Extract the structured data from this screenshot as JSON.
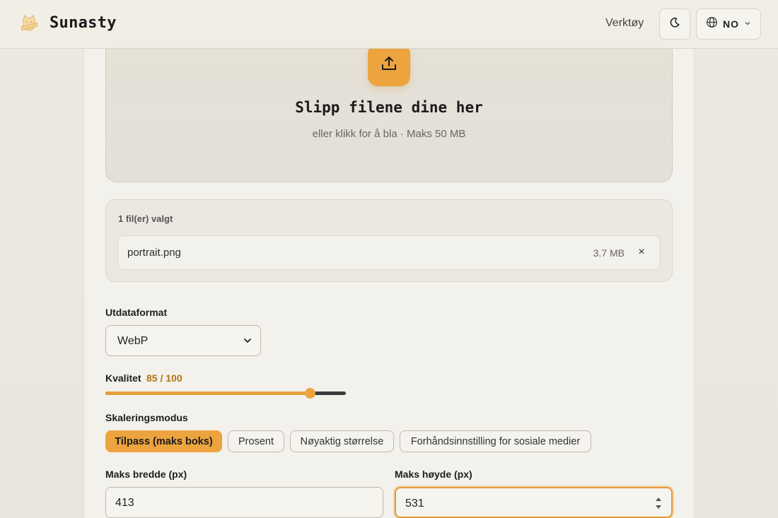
{
  "header": {
    "brand": "Sunasty",
    "tools_label": "Verktøy",
    "language_code": "NO"
  },
  "dropzone": {
    "title": "Slipp filene dine her",
    "subtitle": "eller klikk for å bla · Maks 50 MB"
  },
  "files": {
    "count_label": "1 fil(er) valgt",
    "items": [
      {
        "name": "portrait.png",
        "size": "3.7 MB",
        "remove": "×"
      }
    ]
  },
  "output_format": {
    "label": "Utdataformat",
    "selected": "WebP"
  },
  "quality": {
    "label": "Kvalitet",
    "value_text": "85 / 100",
    "value": 85,
    "max": 100
  },
  "scaling": {
    "label": "Skaleringsmodus",
    "modes": [
      {
        "label": "Tilpass (maks boks)",
        "active": true
      },
      {
        "label": "Prosent",
        "active": false
      },
      {
        "label": "Nøyaktig størrelse",
        "active": false
      },
      {
        "label": "Forhåndsinnstilling for sosiale medier",
        "active": false
      }
    ]
  },
  "dimensions": {
    "width_label": "Maks bredde (px)",
    "width_value": "413",
    "height_label": "Maks høyde (px)",
    "height_value": "531"
  },
  "colors": {
    "accent": "#eda33e",
    "accent_text": "#b07318"
  }
}
